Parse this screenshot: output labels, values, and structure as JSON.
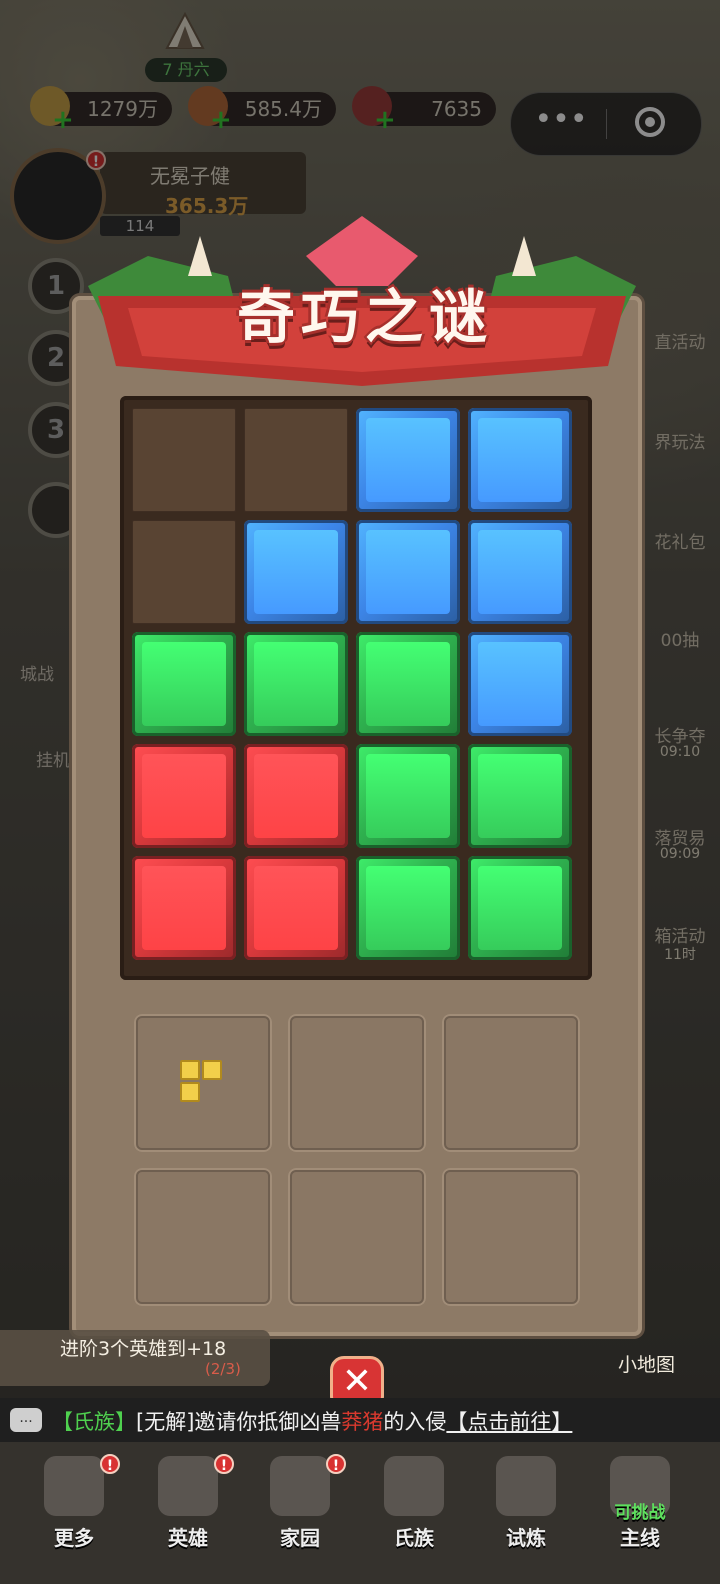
{
  "top": {
    "rank": "7 丹六",
    "resources": [
      "1279万",
      "585.4万",
      "7635"
    ]
  },
  "player": {
    "name": "无冕子健",
    "power": "365.3万",
    "level": "114"
  },
  "left_levels": [
    "1",
    "2",
    "3"
  ],
  "left_labels": [
    "城战",
    "挂机"
  ],
  "right_labels": [
    "直活动",
    "界玩法",
    "花礼包",
    "00抽",
    "长争夺",
    "09:10",
    "落贸易",
    "09:09",
    "箱活动",
    "11时"
  ],
  "puzzle": {
    "title": "奇巧之谜",
    "board": [
      [
        "empty",
        "empty",
        "blue",
        "blue"
      ],
      [
        "empty",
        "blue",
        "blue",
        "blue"
      ],
      [
        "green",
        "green",
        "green",
        "blue"
      ],
      [
        "red",
        "red",
        "green",
        "green"
      ],
      [
        "red",
        "red",
        "green",
        "green"
      ]
    ]
  },
  "quest": {
    "text": "进阶3个英雄到+18",
    "progress": "(2/3)"
  },
  "minimap_label": "小地图",
  "chat": {
    "clan_tag": "【氏族】",
    "sender": "[无解]",
    "msg1": "邀请你抵御凶兽",
    "beast": "莽猪",
    "msg2": "的入侵",
    "link": "【点击前往】",
    "icon": "..."
  },
  "nav": [
    {
      "label": "更多"
    },
    {
      "label": "英雄"
    },
    {
      "label": "家园"
    },
    {
      "label": "氏族"
    },
    {
      "label": "试炼"
    },
    {
      "label": "主线",
      "tag": "可挑战"
    }
  ],
  "badge": "!",
  "colors": {
    "blue": "#3d86e8",
    "green": "#2fb14f",
    "red": "#dd3a3d"
  }
}
